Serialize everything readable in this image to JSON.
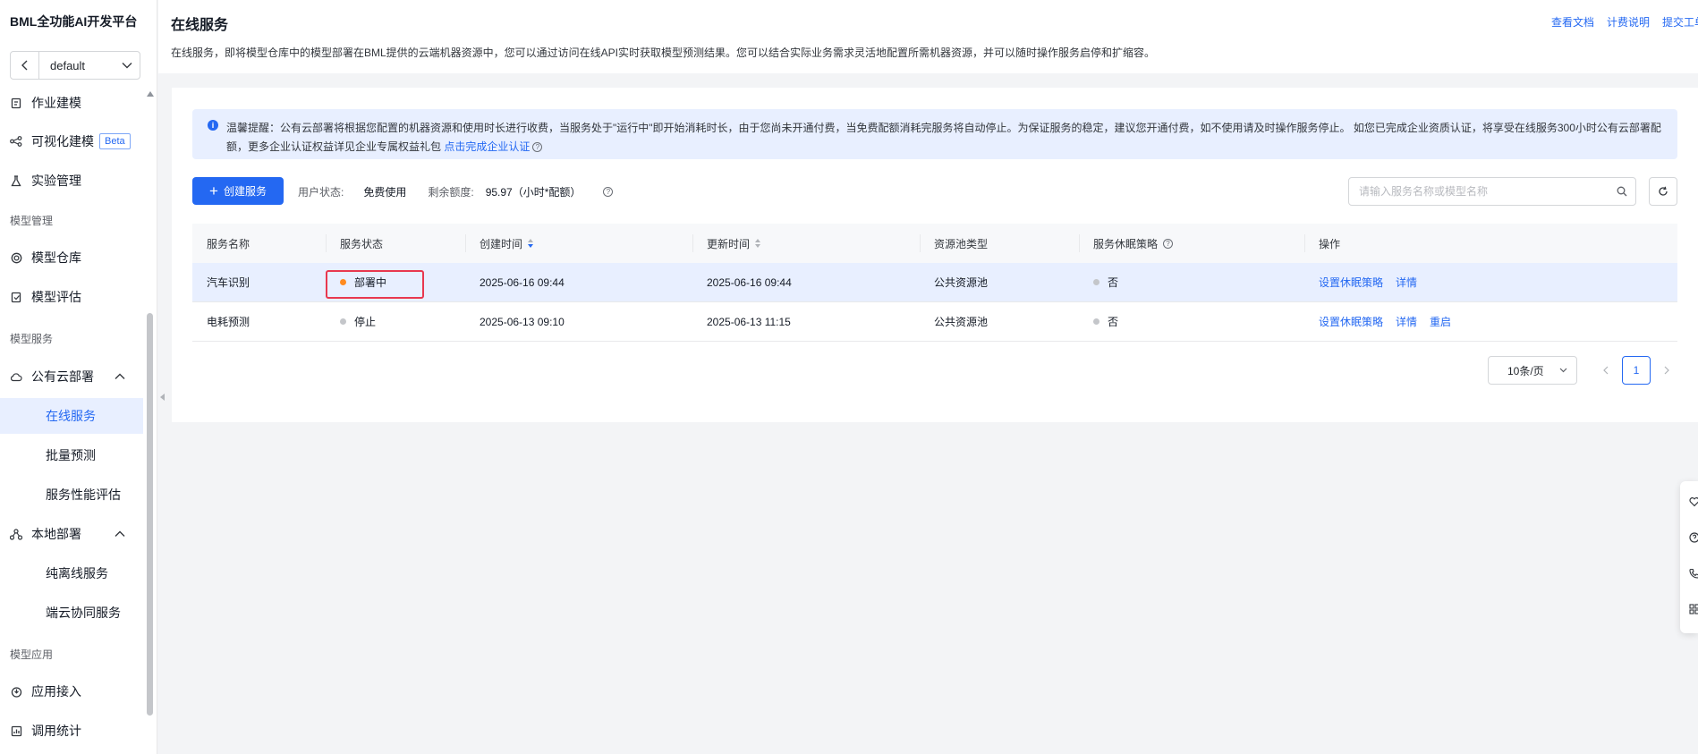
{
  "sidebar": {
    "brand": "BML全功能AI开发平台",
    "project": "default",
    "items": [
      {
        "label": "作业建模"
      },
      {
        "label": "可视化建模",
        "badge": "Beta"
      },
      {
        "label": "实验管理"
      },
      {
        "label": "模型仓库"
      },
      {
        "label": "模型评估"
      },
      {
        "label": "公有云部署"
      },
      {
        "label": "在线服务"
      },
      {
        "label": "批量预测"
      },
      {
        "label": "服务性能评估"
      },
      {
        "label": "本地部署"
      },
      {
        "label": "纯离线服务"
      },
      {
        "label": "端云协同服务"
      },
      {
        "label": "应用接入"
      },
      {
        "label": "调用统计"
      }
    ],
    "groups": [
      "模型管理",
      "模型服务",
      "模型应用"
    ]
  },
  "header": {
    "title": "在线服务",
    "description": "在线服务，即将模型仓库中的模型部署在BML提供的云端机器资源中，您可以通过访问在线API实时获取模型预测结果。您可以结合实际业务需求灵活地配置所需机器资源，并可以随时操作服务启停和扩缩容。",
    "links": [
      "查看文档",
      "计费说明",
      "提交工单"
    ]
  },
  "tip": {
    "text": "温馨提醒：公有云部署将根据您配置的机器资源和使用时长进行收费，当服务处于\"运行中\"即开始消耗时长，由于您尚未开通付费，当免费配额消耗完服务将自动停止。为保证服务的稳定，建议您开通付费，如不使用请及时操作服务停止。 如您已完成企业资质认证，将享受在线服务300小时公有云部署配额，更多企业认证权益详见企业专属权益礼包",
    "link": "点击完成企业认证"
  },
  "toolbar": {
    "create_label": "创建服务",
    "user_status_label": "用户状态:",
    "user_status_value": "免费使用",
    "quota_label": "剩余额度:",
    "quota_value": "95.97（小时*配额）",
    "search_placeholder": "请输入服务名称或模型名称"
  },
  "table": {
    "columns": [
      "服务名称",
      "服务状态",
      "创建时间",
      "更新时间",
      "资源池类型",
      "服务休眠策略",
      "操作"
    ],
    "rows": [
      {
        "name": "汽车识别",
        "status": "部署中",
        "status_color": "#ff8a1f",
        "created": "2025-06-16 09:44",
        "updated": "2025-06-16 09:44",
        "pool": "公共资源池",
        "sleep": "否",
        "ops": [
          "设置休眠策略",
          "详情"
        ]
      },
      {
        "name": "电耗预测",
        "status": "停止",
        "status_color": "#c4c6ca",
        "created": "2025-06-13 09:10",
        "updated": "2025-06-13 11:15",
        "pool": "公共资源池",
        "sleep": "否",
        "ops": [
          "设置休眠策略",
          "详情",
          "重启"
        ]
      }
    ]
  },
  "pagination": {
    "page_size": "10条/页",
    "current_page": "1"
  },
  "colors": {
    "accent": "#2468f2",
    "highlight_border": "#e8384f"
  }
}
